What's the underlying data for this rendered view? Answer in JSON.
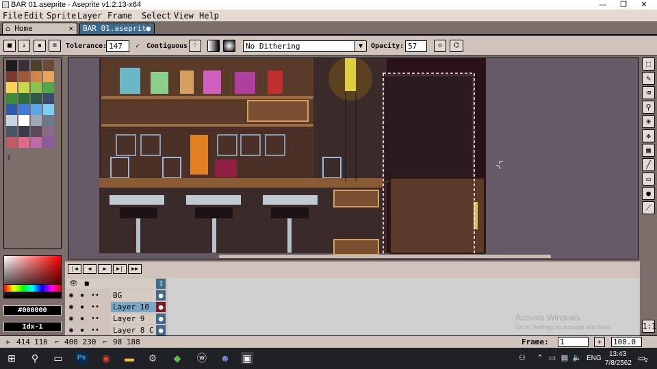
{
  "window": {
    "title": "BAR 01.aseprite - Aseprite v1.2.13-x64",
    "min_glyph": "—",
    "max_glyph": "❐",
    "close_glyph": "✕"
  },
  "menu": [
    "File",
    "Edit",
    "Sprite",
    "Layer",
    "Frame",
    "Select",
    "View",
    "Help"
  ],
  "tabs": [
    {
      "label": "Home",
      "close": "✕"
    },
    {
      "label": "BAR 01.aseprite",
      "modified": "●"
    }
  ],
  "toolbar": {
    "tolerance_label": "Tolerance:",
    "tolerance_value": "147",
    "contiguous_label": "Contiguous",
    "dithering_value": "No Dithering",
    "opacity_label": "Opacity:",
    "opacity_value": "57"
  },
  "palette": {
    "colors": [
      "#1b1b1b",
      "#3a2f3b",
      "#48412d",
      "#6b4a3b",
      "#7a3b2f",
      "#9c5a3c",
      "#d0874a",
      "#e7a55a",
      "#f7d35c",
      "#c9d84a",
      "#8bc34a",
      "#4fa84a",
      "#3e8a3a",
      "#2e6b3a",
      "#2c5a48",
      "#3b4c6e",
      "#2f5aa8",
      "#3f7ad8",
      "#5aa8e7",
      "#7ad0f0",
      "#c8d4e0",
      "#ffffff",
      "#9ca8b8",
      "#6a7a8c",
      "#4a5466",
      "#3b3b4a",
      "#5a4a5a",
      "#8a6a8a",
      "#c05a6a",
      "#e06a8a",
      "#c26aa8",
      "#8c5a9c"
    ]
  },
  "colors": {
    "foreground_hex": "#000000",
    "index_label": "Idx-1"
  },
  "timeline": {
    "frame_number": "1",
    "layers": [
      {
        "name": "BG",
        "active": false
      },
      {
        "name": "Layer 10",
        "active": true
      },
      {
        "name": "Layer 9",
        "active": false
      },
      {
        "name": "Layer 8 C",
        "active": false
      }
    ],
    "watermark_title": "Activate Windows",
    "watermark_sub": "Go to Settings to activate Windows."
  },
  "status": {
    "cursor_x": "414",
    "cursor_y": "116",
    "sprite_size": "400 230",
    "selection_size": "98 188",
    "frame_label": "Frame:",
    "frame_value": "1",
    "zoom_value": "100.0"
  },
  "taskbar": {
    "lang": "ENG",
    "time": "13:43",
    "date": "7/8/2562",
    "notification_count": "2"
  }
}
